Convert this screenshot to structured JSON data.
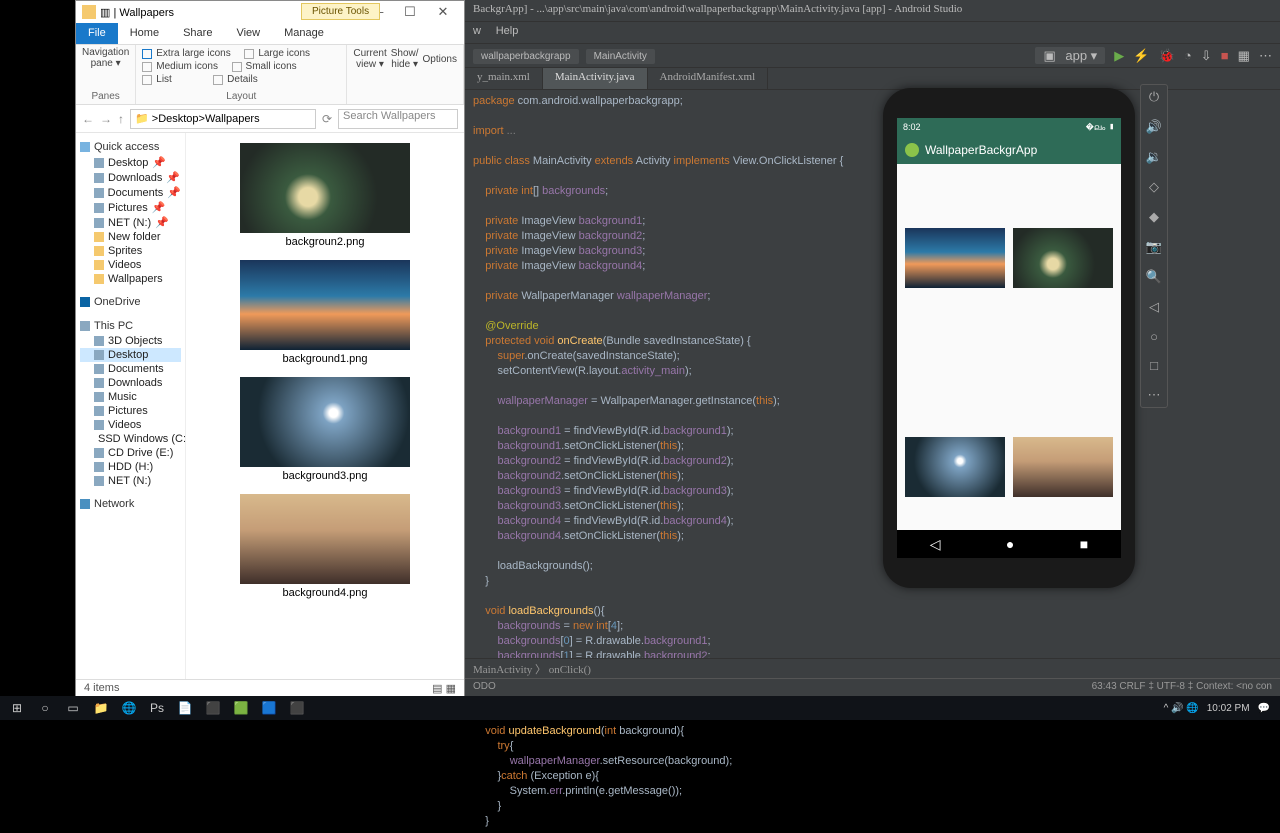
{
  "explorer": {
    "title": "Wallpapers",
    "tooltab": "Picture Tools",
    "tabs": {
      "file": "File",
      "home": "Home",
      "share": "Share",
      "view": "View",
      "manage": "Manage"
    },
    "ribbon": {
      "panes_label": "Panes",
      "navpane": "Navigation\npane ▾",
      "layout_label": "Layout",
      "xl": "Extra large icons",
      "lg": "Large icons",
      "md": "Medium icons",
      "sm": "Small icons",
      "list": "List",
      "details": "Details",
      "curview": "Current\nview ▾",
      "showhide": "Show/\nhide ▾",
      "options": "Options"
    },
    "addr": {
      "crumb1": "Desktop",
      "crumb2": "Wallpapers",
      "search": "Search Wallpapers"
    },
    "nav": {
      "quick": "Quick access",
      "qitems": [
        "Desktop",
        "Downloads",
        "Documents",
        "Pictures",
        "NET (N:)",
        "New folder",
        "Sprites",
        "Videos",
        "Wallpapers"
      ],
      "onedrive": "OneDrive",
      "thispc": "This PC",
      "pcitems": [
        "3D Objects",
        "Desktop",
        "Documents",
        "Downloads",
        "Music",
        "Pictures",
        "Videos",
        "SSD Windows (C:)",
        "CD Drive (E:)",
        "HDD (H:)",
        "NET (N:)"
      ],
      "network": "Network"
    },
    "files": [
      "backgroun2.png",
      "background1.png",
      "background3.png",
      "background4.png"
    ],
    "status": "4 items"
  },
  "studio": {
    "title": "BackgrApp] - ...\\app\\src\\main\\java\\com\\android\\wallpaperbackgrapp\\MainActivity.java [app] - Android Studio",
    "menu": [
      "w",
      "Help"
    ],
    "crumbs": [
      "wallpaperbackgrapp",
      "MainActivity"
    ],
    "run": "app",
    "tabs": [
      "y_main.xml",
      "MainActivity.java",
      "AndroidManifest.xml"
    ],
    "bottom": "MainActivity 〉 onClick()",
    "status": "63:43   CRLF ‡   UTF-8 ‡   Context: <no con",
    "todo": "ODO"
  },
  "emu": {
    "time": "8:02",
    "appname": "WallpaperBackgrApp",
    "sidebar": [
      "⏻",
      "🔊",
      "🔉",
      "◇",
      "◆",
      "📷",
      "🔍",
      "◁",
      "○",
      "□",
      "⋯"
    ]
  },
  "taskbar": {
    "time": "10:02 PM",
    "icons": [
      "⊞",
      "○",
      "▭",
      "📁",
      "🌐",
      "Ps",
      "📄",
      "⬛",
      "🟩",
      "🟦",
      "⬛"
    ]
  }
}
